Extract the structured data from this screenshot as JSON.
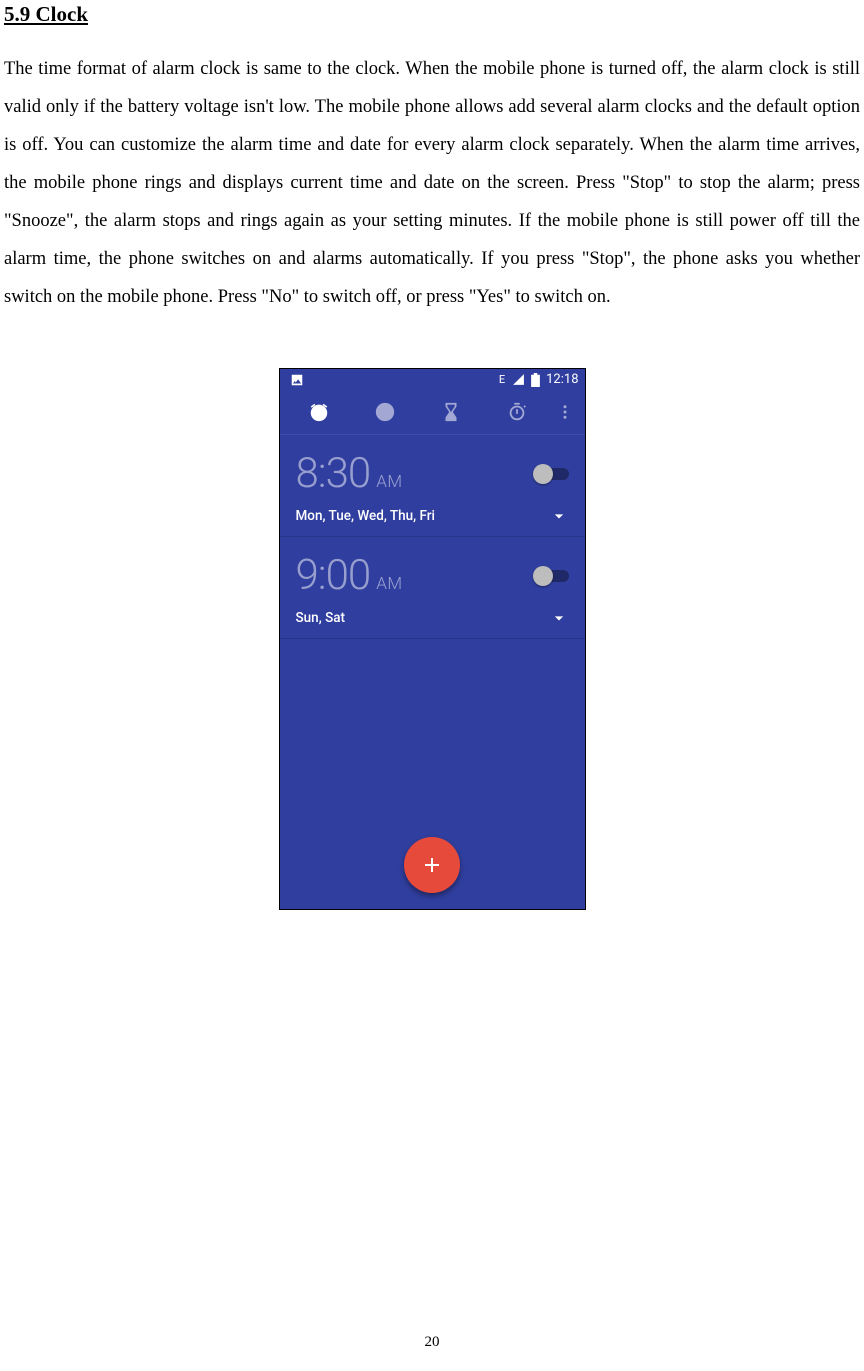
{
  "heading": "5.9 Clock",
  "body": "The time format of alarm clock is same to the clock. When the mobile phone is turned off, the alarm clock is still valid only if the battery voltage isn't low. The mobile phone allows add several alarm clocks and the default option is off. You can customize the alarm time and date for every alarm clock separately. When the alarm time arrives, the mobile phone rings and displays current time and date on the screen. Press \"Stop\" to stop the alarm; press \"Snooze\", the alarm stops and rings again as your setting minutes. If the mobile phone is still power off till the alarm time, the phone switches on and alarms automatically. If you press \"Stop\", the phone asks you whether switch on the mobile phone. Press \"No\" to switch off, or press \"Yes\" to switch on.",
  "pageNumber": "20",
  "screenshot": {
    "statusbar": {
      "leftIndicator": "E",
      "time": "12:18"
    },
    "tabs": [
      "alarm",
      "clock",
      "timer",
      "stopwatch",
      "overflow"
    ],
    "activeTab": 0,
    "alarms": [
      {
        "time": "8:30",
        "ampm": "AM",
        "days": "Mon, Tue, Wed, Thu, Fri",
        "on": false
      },
      {
        "time": "9:00",
        "ampm": "AM",
        "days": "Sun, Sat",
        "on": false
      }
    ]
  }
}
